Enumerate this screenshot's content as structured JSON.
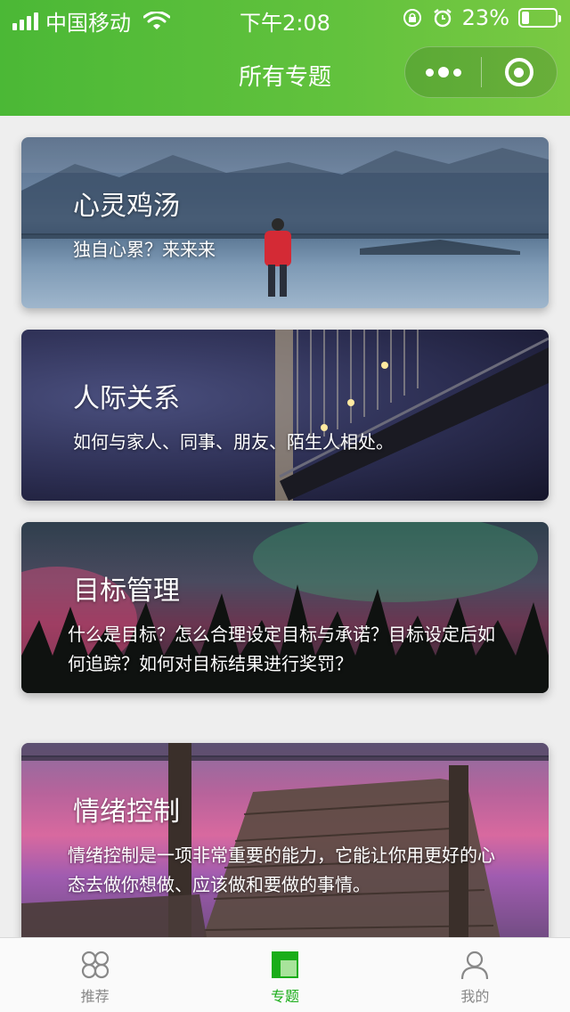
{
  "status_bar": {
    "carrier": "中国移动",
    "time": "下午2:08",
    "battery": "23%",
    "battery_level": 0.23
  },
  "nav": {
    "title": "所有专题",
    "more_icon": "more-dots-icon",
    "close_icon": "target-circle-icon"
  },
  "cards": [
    {
      "title": "心灵鸡汤",
      "desc": "独自心累？来来来"
    },
    {
      "title": "人际关系",
      "desc": "如何与家人、同事、朋友、陌生人相处。"
    },
    {
      "title": "目标管理",
      "desc": "什么是目标？怎么合理设定目标与承诺？目标设定后如何追踪？如何对目标结果进行奖罚？"
    },
    {
      "title": "情绪控制",
      "desc": "情绪控制是一项非常重要的能力，它能让你用更好的心态去做你想做、应该做和要做的事情。"
    }
  ],
  "tabbar": {
    "active_color": "#1aad19",
    "inactive_color": "#888888",
    "tabs": [
      {
        "label": "推荐",
        "icon": "recommend-icon"
      },
      {
        "label": "专题",
        "icon": "topics-icon"
      },
      {
        "label": "我的",
        "icon": "profile-icon"
      }
    ]
  },
  "colors": {
    "header_green": "#5dbd3b"
  }
}
